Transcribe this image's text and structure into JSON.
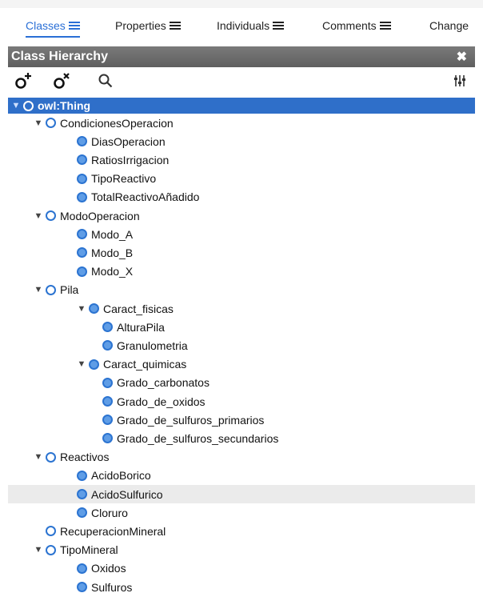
{
  "tabs": [
    {
      "label": "Classes",
      "active": true
    },
    {
      "label": "Properties",
      "active": false
    },
    {
      "label": "Individuals",
      "active": false
    },
    {
      "label": "Comments",
      "active": false
    },
    {
      "label": "Change",
      "active": false
    }
  ],
  "panel": {
    "title": "Class Hierarchy",
    "close_glyph": "✖"
  },
  "toolbar": {
    "add_subclass_icon": "add-subclass-icon",
    "delete_class_icon": "delete-class-icon",
    "search_icon": "search-icon",
    "options_icon": "sliders-icon"
  },
  "tree": [
    {
      "label": "owl:Thing",
      "level": 0,
      "expanded": true,
      "selected": true
    },
    {
      "label": "CondicionesOperacion",
      "level": 1,
      "expanded": true
    },
    {
      "label": "DiasOperacion",
      "level": 2
    },
    {
      "label": "RatiosIrrigacion",
      "level": 2
    },
    {
      "label": "TipoReactivo",
      "level": 2
    },
    {
      "label": "TotalReactivoAñadido",
      "level": 2
    },
    {
      "label": "ModoOperacion",
      "level": 1,
      "expanded": true
    },
    {
      "label": "Modo_A",
      "level": 2
    },
    {
      "label": "Modo_B",
      "level": 2
    },
    {
      "label": "Modo_X",
      "level": 2
    },
    {
      "label": "Pila",
      "level": 1,
      "expanded": true
    },
    {
      "label": "Caract_fisicas",
      "level": 2,
      "expanded": true
    },
    {
      "label": "AlturaPila",
      "level": 3
    },
    {
      "label": "Granulometria",
      "level": 3
    },
    {
      "label": "Caract_quimicas",
      "level": 2,
      "expanded": true
    },
    {
      "label": "Grado_carbonatos",
      "level": 3
    },
    {
      "label": "Grado_de_oxidos",
      "level": 3
    },
    {
      "label": "Grado_de_sulfuros_primarios",
      "level": 3
    },
    {
      "label": "Grado_de_sulfuros_secundarios",
      "level": 3
    },
    {
      "label": "Reactivos",
      "level": 1,
      "expanded": true
    },
    {
      "label": "AcidoBorico",
      "level": 2
    },
    {
      "label": "AcidoSulfurico",
      "level": 2,
      "hover": true
    },
    {
      "label": "Cloruro",
      "level": 2
    },
    {
      "label": "RecuperacionMineral",
      "level": 1
    },
    {
      "label": "TipoMineral",
      "level": 1,
      "expanded": true
    },
    {
      "label": "Oxidos",
      "level": 2
    },
    {
      "label": "Sulfuros",
      "level": 2
    }
  ]
}
